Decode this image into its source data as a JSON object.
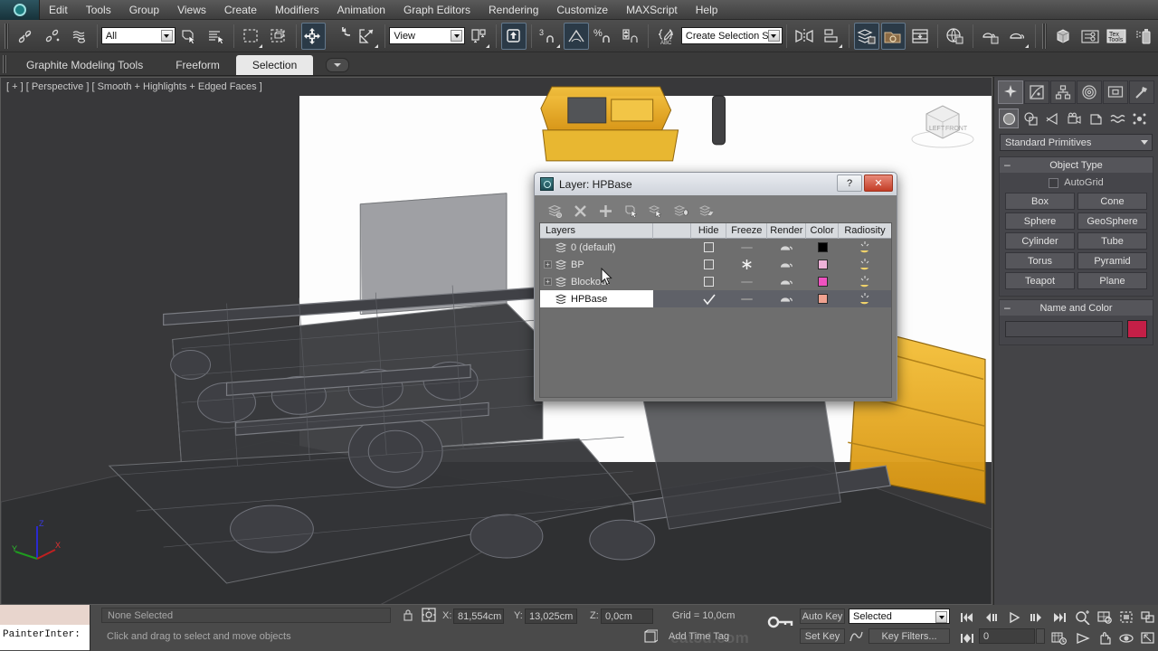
{
  "app": {
    "name": "3ds Max",
    "logo_icon": "max-logo-icon"
  },
  "menu": {
    "items": [
      "Edit",
      "Tools",
      "Group",
      "Views",
      "Create",
      "Modifiers",
      "Animation",
      "Graph Editors",
      "Rendering",
      "Customize",
      "MAXScript",
      "Help"
    ]
  },
  "toolbar": {
    "selection_filter": "All",
    "reference_coord_system": "View",
    "selection_set": "Create Selection Se",
    "snap_value": "3",
    "percent_symbol": "%",
    "buttons": [
      {
        "name": "undo-icon",
        "title": "Undo"
      },
      {
        "name": "redo-icon",
        "title": "Redo"
      },
      {
        "name": "select-link-icon",
        "title": "Select and Link"
      },
      {
        "name": "unlink-selection-icon",
        "title": "Unlink Selection"
      },
      {
        "name": "bind-space-warp-icon",
        "title": "Bind to Space Warp"
      },
      {
        "name": "select-object-icon",
        "title": "Select Object"
      },
      {
        "name": "select-by-name-icon",
        "title": "Select by Name"
      },
      {
        "name": "rectangular-selection-region-icon",
        "title": "Rectangular Selection Region"
      },
      {
        "name": "window-crossing-icon",
        "title": "Window / Crossing"
      },
      {
        "name": "select-and-move-icon",
        "title": "Select and Move"
      },
      {
        "name": "select-and-rotate-icon",
        "title": "Select and Rotate"
      },
      {
        "name": "select-and-scale-icon",
        "title": "Select and Uniform Scale"
      },
      {
        "name": "use-pivot-point-center-icon",
        "title": "Use Pivot Point Center"
      },
      {
        "name": "select-and-manipulate-icon",
        "title": "Select and Manipulate"
      },
      {
        "name": "snaps-toggle-icon",
        "title": "Snaps Toggle"
      },
      {
        "name": "angle-snap-toggle-icon",
        "title": "Angle Snap Toggle"
      },
      {
        "name": "percent-snap-toggle-icon",
        "title": "Percent Snap Toggle"
      },
      {
        "name": "spinner-snap-toggle-icon",
        "title": "Spinner Snap Toggle"
      },
      {
        "name": "named-selection-sets-icon",
        "title": "Edit Named Selection Sets"
      },
      {
        "name": "mirror-icon",
        "title": "Mirror"
      },
      {
        "name": "align-icon",
        "title": "Align"
      },
      {
        "name": "layer-manager-icon",
        "title": "Layer Manager"
      },
      {
        "name": "material-editor-icon",
        "title": "Material Editor"
      },
      {
        "name": "curve-editor-icon",
        "title": "Curve Editor"
      },
      {
        "name": "schematic-view-icon",
        "title": "Schematic View"
      },
      {
        "name": "render-setup-icon",
        "title": "Render Setup"
      },
      {
        "name": "rendered-frame-window-icon",
        "title": "Rendered Frame Window"
      },
      {
        "name": "render-production-icon",
        "title": "Render Production"
      },
      {
        "name": "viewcube-icon",
        "title": "ViewCube"
      },
      {
        "name": "graphite-tools-icon",
        "title": "Graphite Tools"
      },
      {
        "name": "textools-icon",
        "title": "TexTools"
      },
      {
        "name": "spray-icon",
        "title": "Spray"
      }
    ]
  },
  "ribbon": {
    "tabs": [
      {
        "label": "Graphite Modeling Tools",
        "active": false
      },
      {
        "label": "Freeform",
        "active": false
      },
      {
        "label": "Selection",
        "active": true
      }
    ],
    "dropdown_icon": "chevron-down-icon"
  },
  "viewport": {
    "label": "[ + ] [ Perspective ] [ Smooth + Highlights + Edged Faces ]",
    "viewcube": {
      "face_left": "LEFT",
      "face_front": "FRONT"
    },
    "axis": {
      "x": "X",
      "y": "Y",
      "z": "Z",
      "x_color": "#cc2222",
      "y_color": "#22aa22",
      "z_color": "#2222cc"
    }
  },
  "command_panel": {
    "tabs": [
      {
        "name": "create-tab",
        "icon": "star-burst-icon",
        "active": true
      },
      {
        "name": "modify-tab",
        "icon": "curve-arc-icon",
        "active": false
      },
      {
        "name": "hierarchy-tab",
        "icon": "hierarchy-icon",
        "active": false
      },
      {
        "name": "motion-tab",
        "icon": "motion-rings-icon",
        "active": false
      },
      {
        "name": "display-tab",
        "icon": "display-monitor-icon",
        "active": false
      },
      {
        "name": "utilities-tab",
        "icon": "hammer-icon",
        "active": false
      }
    ],
    "categories": [
      {
        "name": "geometry-category",
        "icon": "sphere-icon",
        "active": true
      },
      {
        "name": "shapes-category",
        "icon": "shapes-icon",
        "active": false
      },
      {
        "name": "lights-category",
        "icon": "light-icon",
        "active": false
      },
      {
        "name": "cameras-category",
        "icon": "camera-icon",
        "active": false
      },
      {
        "name": "helpers-category",
        "icon": "helper-icon",
        "active": false
      },
      {
        "name": "space-warps-category",
        "icon": "wave-icon",
        "active": false
      },
      {
        "name": "systems-category",
        "icon": "systems-icon",
        "active": false
      }
    ],
    "category_select": "Standard Primitives",
    "object_type": {
      "title": "Object Type",
      "autogrid_label": "AutoGrid",
      "autogrid_checked": false,
      "buttons": [
        "Box",
        "Cone",
        "Sphere",
        "GeoSphere",
        "Cylinder",
        "Tube",
        "Torus",
        "Pyramid",
        "Teapot",
        "Plane"
      ]
    },
    "name_and_color": {
      "title": "Name and Color",
      "name_value": "",
      "color": "#c41f47"
    }
  },
  "layer_dialog": {
    "title": "Layer: HPBase",
    "icon": "max-layer-icon",
    "help_label": "?",
    "close_label": "✕",
    "toolbar": [
      {
        "name": "new-layer-icon",
        "title": "Create New Layer"
      },
      {
        "name": "delete-layer-icon",
        "title": "Delete Highlighted Layers"
      },
      {
        "name": "add-selection-icon",
        "title": "Add Selected Objects to Highlighted Layer"
      },
      {
        "name": "select-objects-icon",
        "title": "Select Objects in Highlighted Layers"
      },
      {
        "name": "highlight-selected-icon",
        "title": "Highlight Selected Objects Layers"
      },
      {
        "name": "set-current-icon",
        "title": "Set Current Layer to Selection"
      },
      {
        "name": "layer-properties-icon",
        "title": "Layer Properties"
      }
    ],
    "columns": [
      "Layers",
      "",
      "Hide",
      "Freeze",
      "Render",
      "Color",
      "Radiosity"
    ],
    "rows": [
      {
        "name": "0 (default)",
        "expandable": false,
        "current": false,
        "hide": "checkbox",
        "freeze": "dash",
        "render": "teapot",
        "color": "#000000",
        "radiosity": "radiosity-icon"
      },
      {
        "name": "BP",
        "expandable": true,
        "current": false,
        "hide": "checkbox",
        "freeze": "snowflake",
        "render": "teapot",
        "color": "#eeb2d8",
        "radiosity": "radiosity-icon"
      },
      {
        "name": "Blockout",
        "expandable": true,
        "current": false,
        "hide": "checkbox",
        "freeze": "dash",
        "render": "teapot",
        "color": "#ef52c0",
        "radiosity": "radiosity-icon"
      },
      {
        "name": "HPBase",
        "expandable": false,
        "current": true,
        "hide": "check",
        "freeze": "dash",
        "render": "teapot",
        "color": "#f0a290",
        "radiosity": "radiosity-icon"
      }
    ]
  },
  "status_bar": {
    "maxscript_color_swatch": "#e8d5cd",
    "maxscript_listener": "PainterInter:",
    "selection_status": "None Selected",
    "prompt": "Click and drag to select and move objects",
    "lock_icon": "lock-icon",
    "absolute_mode_icon": "absolute-mode-icon",
    "coords": [
      {
        "label": "X:",
        "value": "81,554cm"
      },
      {
        "label": "Y:",
        "value": "13,025cm"
      },
      {
        "label": "Z:",
        "value": "0,0cm"
      }
    ],
    "grid": "Grid = 10,0cm",
    "key_mode_icon": "key-icon",
    "watermark": "eat3d.com",
    "time_tag": "Add Time Tag",
    "time_tag_icon": "time-tag-icon"
  },
  "animation_bar": {
    "auto_key": "Auto Key",
    "set_key": "Set Key",
    "key_mode_select": "Selected",
    "key_filters": "Key Filters...",
    "curve_icon": "curve-icon",
    "frame_value": "0",
    "transport": [
      {
        "name": "go-to-start-icon"
      },
      {
        "name": "previous-frame-icon"
      },
      {
        "name": "play-icon"
      },
      {
        "name": "next-frame-icon"
      },
      {
        "name": "go-to-end-icon"
      }
    ],
    "nav": [
      {
        "name": "zoom-icon"
      },
      {
        "name": "zoom-all-icon"
      },
      {
        "name": "zoom-extents-icon"
      },
      {
        "name": "zoom-region-icon"
      },
      {
        "name": "key-mode-toggle-icon"
      },
      {
        "name": "time-configuration-icon"
      },
      {
        "name": "field-of-view-icon"
      },
      {
        "name": "pan-icon"
      },
      {
        "name": "orbit-icon"
      },
      {
        "name": "maximize-viewport-icon"
      }
    ]
  }
}
